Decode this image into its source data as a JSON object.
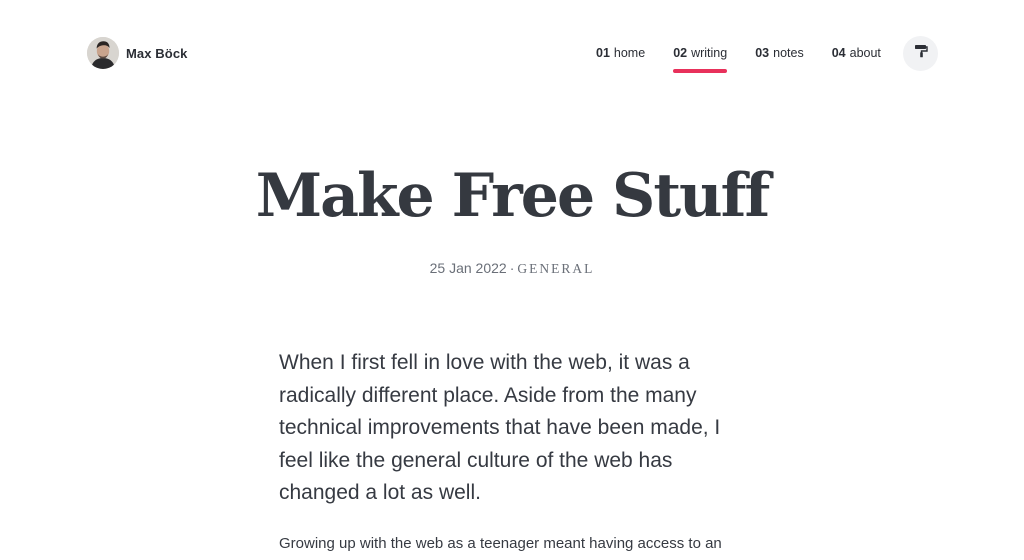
{
  "site": {
    "author_name": "Max Böck"
  },
  "nav": {
    "items": [
      {
        "num": "01",
        "label": "home",
        "active": false
      },
      {
        "num": "02",
        "label": "writing",
        "active": true
      },
      {
        "num": "03",
        "label": "notes",
        "active": false
      },
      {
        "num": "04",
        "label": "about",
        "active": false
      }
    ],
    "accent_color": "#e8315b",
    "theme_toggle_icon": "paint-roller-icon"
  },
  "article": {
    "title": "Make Free Stuff",
    "date": "25 Jan 2022",
    "separator": "·",
    "category": "GENERAL",
    "lead": "When I first fell in love with the web, it was a radically different place. Aside from the many technical improvements that have been made, I feel like the general culture of the web has changed a lot as well.",
    "paragraph": "Growing up with the web as a teenager meant having access to an"
  }
}
